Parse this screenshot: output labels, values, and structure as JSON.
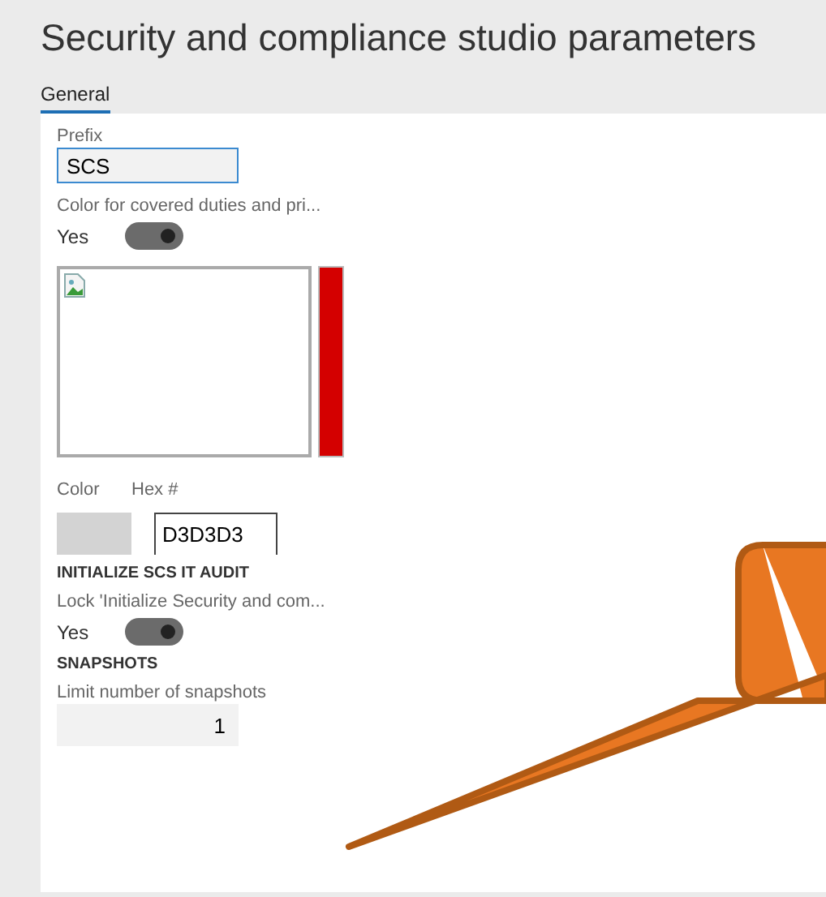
{
  "page": {
    "title": "Security and compliance studio parameters"
  },
  "tabs": [
    {
      "label": "General",
      "selected": true
    }
  ],
  "prefix": {
    "label": "Prefix",
    "value": "SCS"
  },
  "covered_color": {
    "label": "Color for covered duties and pri...",
    "toggle_text": "Yes",
    "on": true
  },
  "color_picker": {
    "color_label": "Color",
    "hex_label": "Hex #",
    "color": "#d3d3d3",
    "hex_value": "D3D3D3"
  },
  "it_audit": {
    "heading": "INITIALIZE SCS IT AUDIT",
    "label": "Lock 'Initialize Security and com...",
    "toggle_text": "Yes",
    "on": true
  },
  "snapshots": {
    "heading": "SNAPSHOTS",
    "label": "Limit number of snapshots",
    "value": "1"
  }
}
